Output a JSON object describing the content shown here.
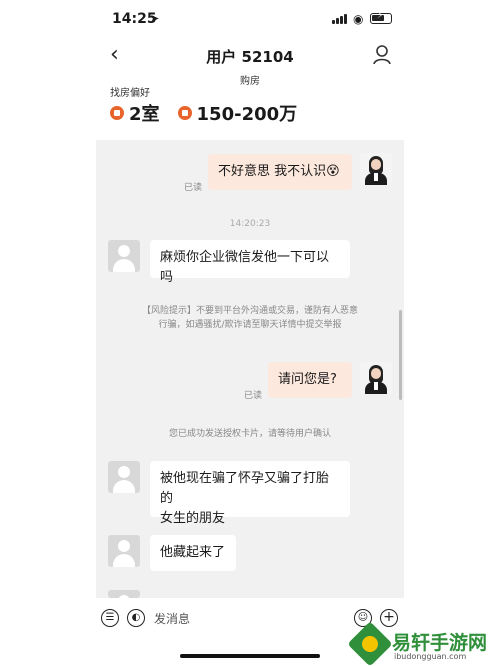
{
  "status_bar": {
    "time": "14:25"
  },
  "header": {
    "title": "用户 52104",
    "subtitle": "购房"
  },
  "preference": {
    "label": "找房偏好",
    "rooms": "2室",
    "budget": "150-200万"
  },
  "messages": [
    {
      "side": "me",
      "text": "不好意思  我不认识😵",
      "read": "已读"
    },
    {
      "type": "timestamp",
      "text": "14:20:23"
    },
    {
      "side": "them",
      "text": "麻烦你企业微信发他一下可以吗"
    },
    {
      "type": "system",
      "line1": "【风险提示】不要到平台外沟通或交易，谨防有人恶意",
      "line2": "行骗，如遇骚扰/欺诈请至聊天详情中提交举报"
    },
    {
      "side": "me",
      "text": "请问您是?",
      "read": "已读"
    },
    {
      "type": "system",
      "line1": "您已成功发送授权卡片，请等待用户确认"
    },
    {
      "side": "them",
      "line1": "被他现在骗了怀孕又骗了打胎的",
      "line2": "女生的朋友"
    },
    {
      "side": "them",
      "text": "他藏起来了"
    }
  ],
  "input": {
    "placeholder": "发消息"
  },
  "watermark": {
    "name": "易轩手游网",
    "url": "ibudongguan.com"
  },
  "colors": {
    "accent": "#e8642b",
    "my_bubble": "#fde8dd",
    "chat_bg": "#f1f1f1"
  }
}
